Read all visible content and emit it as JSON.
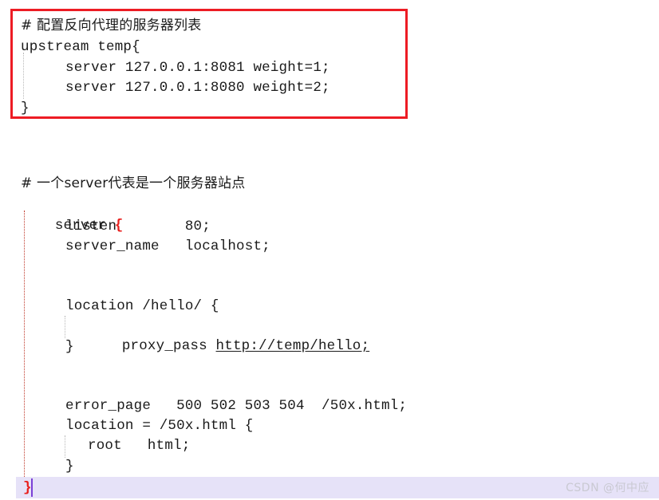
{
  "editor": {
    "language": "nginx-conf",
    "background_color": "#ffffff",
    "text_color": "#1a1a1a",
    "accent_red": "#ed1c24",
    "current_line_color": "#e6e2f8",
    "caret_color": "#7a3fd6",
    "indent_guide_color": "#b8b8b8",
    "active_indent_guide_color": "#c0392b"
  },
  "callout": {
    "name": "upstream-block-highlight",
    "border_color": "#ed1c24",
    "border_width": "3px"
  },
  "upstream_block": {
    "lines": [
      {
        "id": "u1",
        "indent": 0,
        "text": "# 配置反向代理的服务器列表",
        "cjk": true
      },
      {
        "id": "u2",
        "indent": 0,
        "text": "upstream temp{"
      },
      {
        "id": "u3",
        "indent": 1,
        "text": "server 127.0.0.1:8081 weight=1;"
      },
      {
        "id": "u4",
        "indent": 1,
        "text": "server 127.0.0.1:8080 weight=2;"
      },
      {
        "id": "u5",
        "indent": 0,
        "text": "}"
      }
    ]
  },
  "server_block": {
    "comment": "# 一个server代表是一个服务器站点",
    "open_keyword": "server ",
    "open_brace": "{",
    "lines": [
      {
        "id": "s1",
        "indent": 1,
        "text": "listen        80;"
      },
      {
        "id": "s2",
        "indent": 1,
        "text": "server_name   localhost;"
      },
      {
        "id": "s3",
        "indent": 1,
        "text": "location /hello/ {"
      },
      {
        "id": "s4",
        "indent": 2,
        "prefix": "proxy_pass ",
        "link": "http://temp/hello;"
      },
      {
        "id": "s5",
        "indent": 1,
        "text": "}"
      },
      {
        "id": "s6",
        "indent": 1,
        "text": "error_page   500 502 503 504  /50x.html;"
      },
      {
        "id": "s7",
        "indent": 1,
        "text": "location = /50x.html {"
      },
      {
        "id": "s8",
        "indent": 2,
        "text": "root   html;"
      },
      {
        "id": "s9",
        "indent": 1,
        "text": "}"
      }
    ],
    "close_brace": "}"
  },
  "watermark": {
    "text": "CSDN @何中应"
  }
}
